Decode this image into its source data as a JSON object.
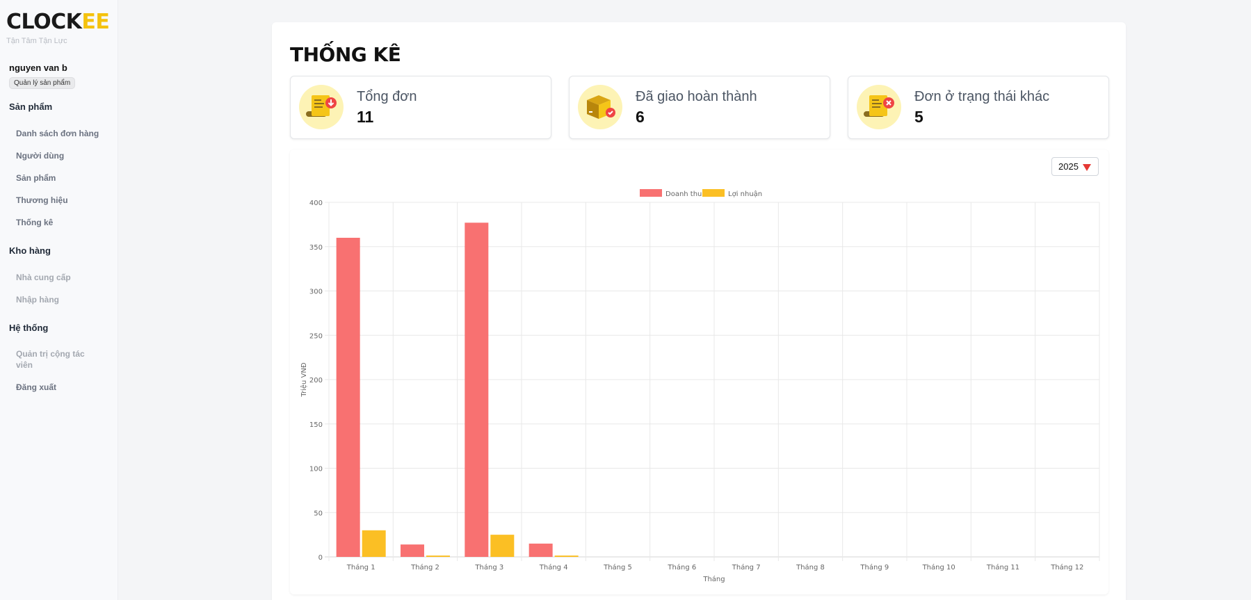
{
  "sidebar": {
    "logo_dark": "CLOCK",
    "logo_accent": "EE",
    "tagline": "Tận Tâm Tận Lực",
    "user": {
      "name": "nguyen van b",
      "role": "Quản lý sản phẩm"
    },
    "sections": [
      {
        "title": "Sản phẩm",
        "items": [
          "Danh sách đơn hàng",
          "Người dùng",
          "Sản phẩm",
          "Thương hiệu",
          "Thống kê"
        ]
      },
      {
        "title": "Kho hàng",
        "items": [
          "Nhà cung cấp",
          "Nhập hàng"
        ]
      },
      {
        "title": "Hệ thống",
        "items": [
          "Quản trị cộng tác viên",
          "Đăng xuất"
        ]
      }
    ]
  },
  "page": {
    "title": "THỐNG KÊ"
  },
  "stats": [
    {
      "label": "Tổng đơn",
      "value": "11",
      "icon": "receipt-download-icon"
    },
    {
      "label": "Đã giao hoàn thành",
      "value": "6",
      "icon": "box-check-icon"
    },
    {
      "label": "Đơn ở trạng thái khác",
      "value": "5",
      "icon": "receipt-cancel-icon"
    }
  ],
  "filter": {
    "year": "2025"
  },
  "colors": {
    "accent": "#f4c20d",
    "revenue": "#f87171",
    "profit": "#fbbf24",
    "badge": "#ef4444",
    "icon_bg": "#fdf3b5"
  },
  "chart_data": {
    "type": "bar",
    "xlabel": "Tháng",
    "ylabel": "Triệu VNĐ",
    "ylim": [
      0,
      400
    ],
    "yticks": [
      0,
      50,
      100,
      150,
      200,
      250,
      300,
      350,
      400
    ],
    "grid": true,
    "legend_position": "top-center",
    "categories": [
      "Tháng 1",
      "Tháng 2",
      "Tháng 3",
      "Tháng 4",
      "Tháng 5",
      "Tháng 6",
      "Tháng 7",
      "Tháng 8",
      "Tháng 9",
      "Tháng 10",
      "Tháng 11",
      "Tháng 12"
    ],
    "series": [
      {
        "name": "Doanh thu",
        "color": "#f87171",
        "values": [
          360,
          14,
          377,
          15,
          0,
          0,
          0,
          0,
          0,
          0,
          0,
          0
        ]
      },
      {
        "name": "Lợi nhuận",
        "color": "#fbbf24",
        "values": [
          30,
          1.5,
          25,
          1.5,
          0,
          0,
          0,
          0,
          0,
          0,
          0,
          0
        ]
      }
    ]
  }
}
